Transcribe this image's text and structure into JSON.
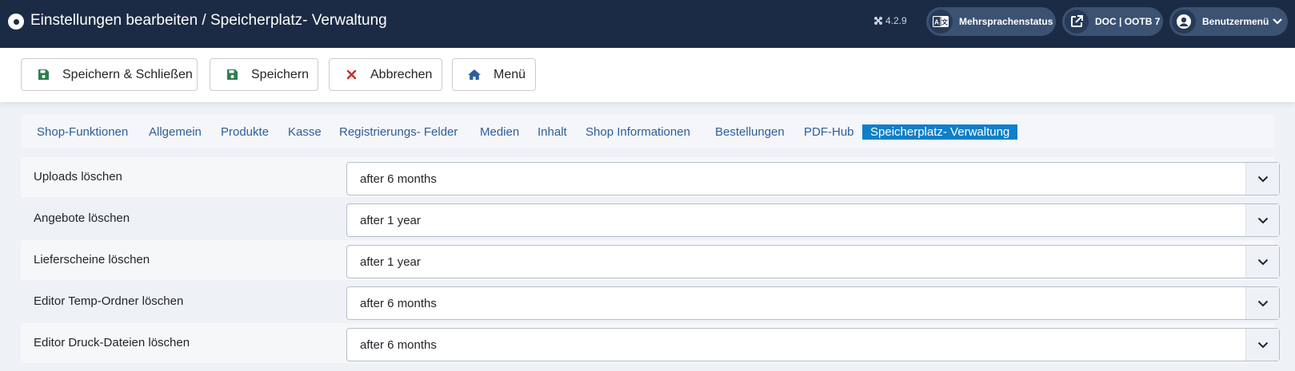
{
  "header": {
    "title": "Einstellungen bearbeiten / Speicherplatz- Verwaltung",
    "version": "4.2.9",
    "lang_status": "Mehrsprachenstatus",
    "doc_link": "DOC | OOTB 7",
    "user_menu": "Benutzermenü",
    "bg_color": "#1c2b45"
  },
  "toolbar": {
    "save_close_label": "Speichern & Schließen",
    "save_label": "Speichern",
    "cancel_label": "Abbrechen",
    "menu_label": "Menü",
    "icons": [
      "save-icon",
      "save-icon",
      "close-icon",
      "home-icon"
    ]
  },
  "tabs": [
    {
      "label": "Shop-Funktionen",
      "active": false
    },
    {
      "label": "Allgemein",
      "active": false
    },
    {
      "label": "Produkte",
      "active": false
    },
    {
      "label": "Kasse",
      "active": false
    },
    {
      "label": "Registrierungs- Felder",
      "active": false
    },
    {
      "label": "Medien",
      "active": false
    },
    {
      "label": "Inhalt",
      "active": false
    },
    {
      "label": "Shop Informationen",
      "active": false
    },
    {
      "label": "Bestellungen",
      "active": false
    },
    {
      "label": "PDF-Hub",
      "active": false
    },
    {
      "label": "Speicherplatz- Verwaltung",
      "active": true
    }
  ],
  "settings": [
    {
      "label": "Uploads löschen",
      "value": "after 6 months"
    },
    {
      "label": "Angebote löschen",
      "value": "after 1 year"
    },
    {
      "label": "Lieferscheine löschen",
      "value": "after 1 year"
    },
    {
      "label": "Editor Temp-Ordner löschen",
      "value": "after 6 months"
    },
    {
      "label": "Editor Druck-Dateien löschen",
      "value": "after 6 months"
    }
  ],
  "colors": {
    "accent": "#0e7fc9",
    "link": "#2f5d9c",
    "save_icon": "#2e7d4f",
    "cancel_icon": "#c9302c",
    "home_icon": "#2f5d9c"
  }
}
